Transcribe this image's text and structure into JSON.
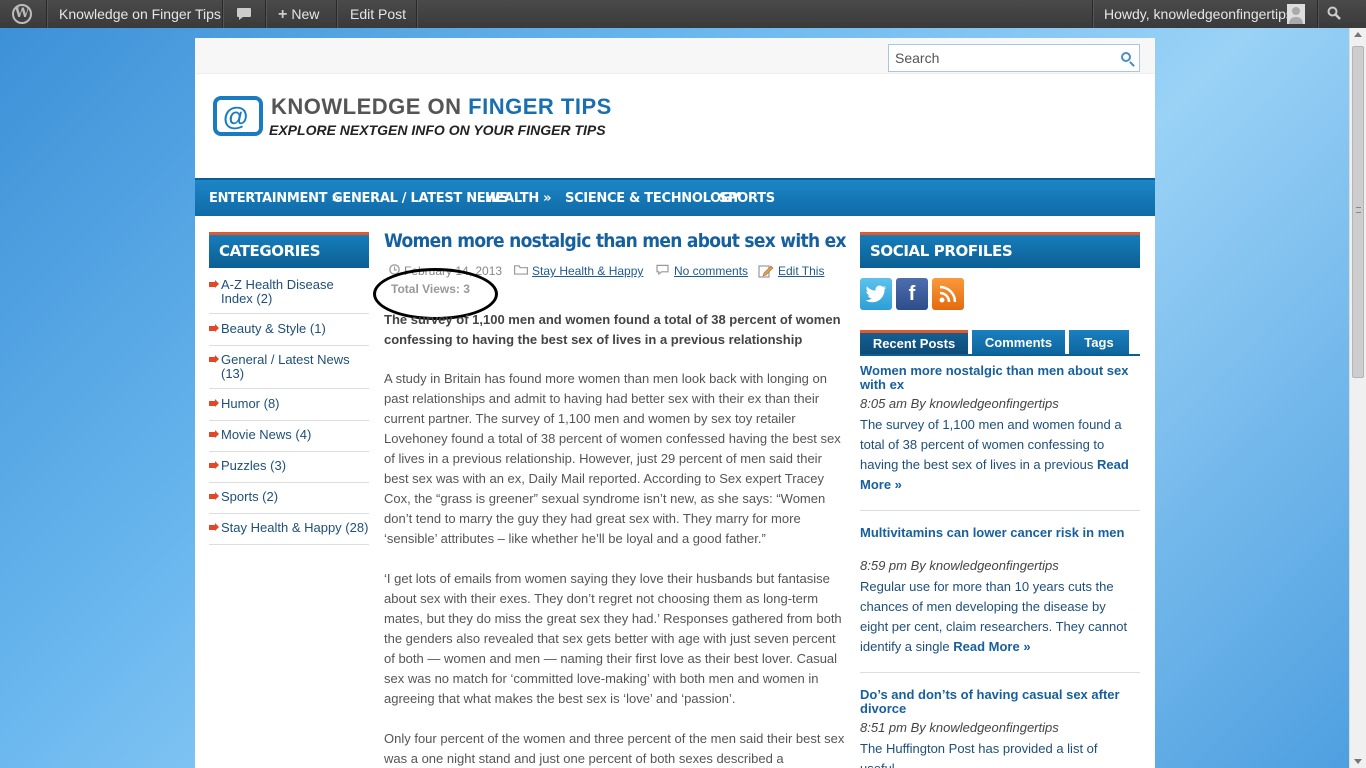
{
  "adminbar": {
    "site": "Knowledge on Finger Tips",
    "new": "New",
    "edit": "Edit Post",
    "howdy": "Howdy, knowledgeonfingertips"
  },
  "search": {
    "placeholder": "Search"
  },
  "logo": {
    "title_a": "KNOWLEDGE ON ",
    "title_b": "FINGER TIPS",
    "subtitle": "EXPLORE NEXTGEN INFO ON YOUR FINGER TIPS"
  },
  "nav": [
    "ENTERTAINMENT",
    "GENERAL / LATEST NEWS",
    "HEALTH",
    "SCIENCE & TECHNOLOGY",
    "SPORTS"
  ],
  "categories": {
    "heading": "CATEGORIES",
    "items": [
      "A-Z Health Disease Index (2)",
      "Beauty & Style (1)",
      "General / Latest News (13)",
      "Humor (8)",
      "Movie News (4)",
      "Puzzles (3)",
      "Sports (2)",
      "Stay Health & Happy (28)"
    ]
  },
  "post": {
    "title": "Women more nostalgic than men about sex with ex",
    "date": "February 14, 2013",
    "category": "Stay Health & Happy",
    "comments": "No comments",
    "edit": "Edit This",
    "views": "Total Views: 3",
    "lead": "The survey of 1,100 men and women found a total of 38 percent of women confessing to having the best sex of lives in a previous relationship",
    "p1": "A study in Britain has found more women than men look back with longing on past relationships and admit to having had better sex with their ex than their current partner. The survey of 1,100 men and women by sex toy retailer Lovehoney found a total of 38 percent of women confessed having the best sex of lives in a previous relationship. However, just 29 percent of men said their best sex was with an ex, Daily Mail reported. According to Sex expert Tracey Cox, the “grass is greener” sexual syndrome isn’t new, as she says: “Women don’t tend to marry the guy they had great sex with. They marry for more ‘sensible’ attributes – like whether he’ll be loyal and a good father.”",
    "p2": "‘I get lots of emails from women saying they love their husbands but fantasise about sex with their exes. They don’t regret not choosing them as long-term mates, but they do miss the great sex they had.’ Responses gathered from both the genders also revealed that sex gets better with age with just seven percent of both — women and men — naming their first love as their best lover. Casual sex was no match for ‘committed love-making’ with both men and women in agreeing that what makes the best sex is ‘love’ and ‘passion’.",
    "p3": "Only four percent of the women and three percent of the men said their best sex was a one night stand and just one percent of both sexes described a"
  },
  "social": {
    "heading": "SOCIAL PROFILES",
    "tabs": [
      "Recent Posts",
      "Comments",
      "Tags"
    ],
    "posts": [
      {
        "title": "Women more nostalgic than men about sex with ex",
        "meta": "8:05 am By knowledgeonfingertips",
        "text": "The survey of 1,100 men and women found a total of 38 percent of women confessing to having the best sex of lives in a previous",
        "more": "Read More »"
      },
      {
        "title": "Multivitamins can lower cancer risk in men",
        "meta": "8:59 pm By knowledgeonfingertips",
        "text": "Regular use for more than 10 years cuts the chances of men developing the disease by eight per cent, claim researchers. They cannot identify a single",
        "more": "Read More »"
      },
      {
        "title": "Do’s and don’ts of having casual sex after divorce",
        "meta": "8:51 pm By knowledgeonfingertips",
        "text": "The Huffington Post has provided a list of useful"
      }
    ]
  },
  "colors": {
    "accent": "#1a6fb0",
    "highlight": "#e25a2b"
  }
}
